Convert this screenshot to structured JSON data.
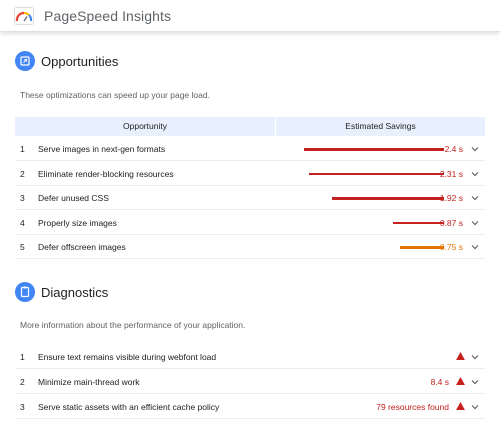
{
  "app": {
    "title": "PageSpeed Insights",
    "logo_icon": "pagespeed-gauge-icon"
  },
  "colors": {
    "accent": "#4285f4",
    "fail": "#c5221f",
    "average": "#e37400",
    "header_bg": "#e8f0fe"
  },
  "opportunities": {
    "title": "Opportunities",
    "icon": "opportunity-icon",
    "description": "These optimizations can speed up your page load.",
    "headers": {
      "opportunity": "Opportunity",
      "savings": "Estimated Savings"
    },
    "items": [
      {
        "num": "1",
        "label": "Serve images in next-gen formats",
        "value": "2.4 s",
        "seconds": 2.4,
        "status": "fail"
      },
      {
        "num": "2",
        "label": "Eliminate render-blocking resources",
        "value": "2.31 s",
        "seconds": 2.31,
        "status": "fail"
      },
      {
        "num": "3",
        "label": "Defer unused CSS",
        "value": "1.92 s",
        "seconds": 1.92,
        "status": "fail"
      },
      {
        "num": "4",
        "label": "Properly size images",
        "value": "0.87 s",
        "seconds": 0.87,
        "status": "fail"
      },
      {
        "num": "5",
        "label": "Defer offscreen images",
        "value": "0.75 s",
        "seconds": 0.75,
        "status": "average"
      }
    ]
  },
  "diagnostics": {
    "title": "Diagnostics",
    "icon": "clipboard-icon",
    "description": "More information about the performance of your application.",
    "items": [
      {
        "num": "1",
        "label": "Ensure text remains visible during webfont load",
        "value": "",
        "status": "fail"
      },
      {
        "num": "2",
        "label": "Minimize main-thread work",
        "value": "8.4 s",
        "status": "fail"
      },
      {
        "num": "3",
        "label": "Serve static assets with an efficient cache policy",
        "value": "79 resources found",
        "status": "fail"
      }
    ]
  }
}
